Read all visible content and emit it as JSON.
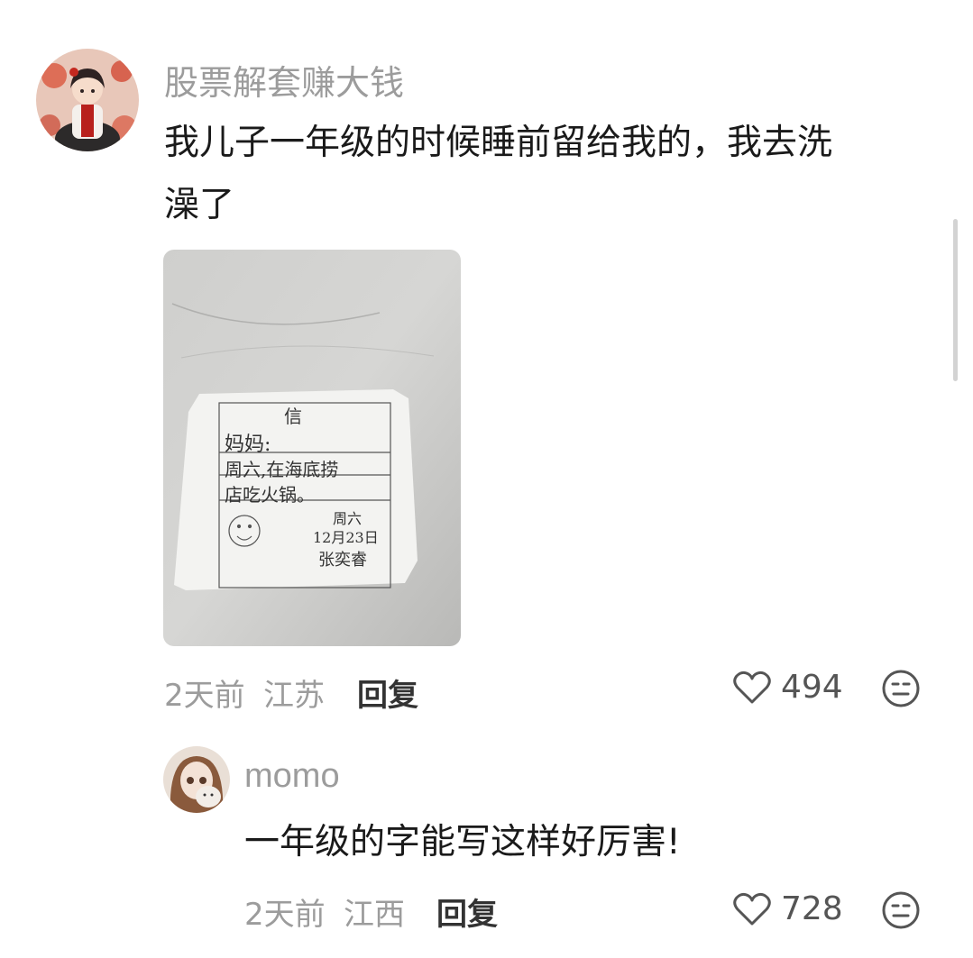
{
  "comments": [
    {
      "username": "股票解套赚大钱",
      "text_line1": "我儿子一年级的时候睡前留给我的，我去洗",
      "text_line2": "澡了",
      "time": "2天前",
      "location": "江苏",
      "reply_label": "回复",
      "likes": "494",
      "photo": {
        "note_title": "信",
        "note_line1": "妈妈:",
        "note_line2": "周六,在海底捞",
        "note_line3": "店吃火锅。",
        "note_date1": "周六",
        "note_date2": "12月23日",
        "note_signature": "张奕睿"
      }
    },
    {
      "username": "momo",
      "text": "一年级的字能写这样好厉害!",
      "time": "2天前",
      "location": "江西",
      "reply_label": "回复",
      "likes": "728"
    }
  ],
  "icons": {
    "like": "heart-outline-icon",
    "dislike": "meh-face-icon"
  }
}
